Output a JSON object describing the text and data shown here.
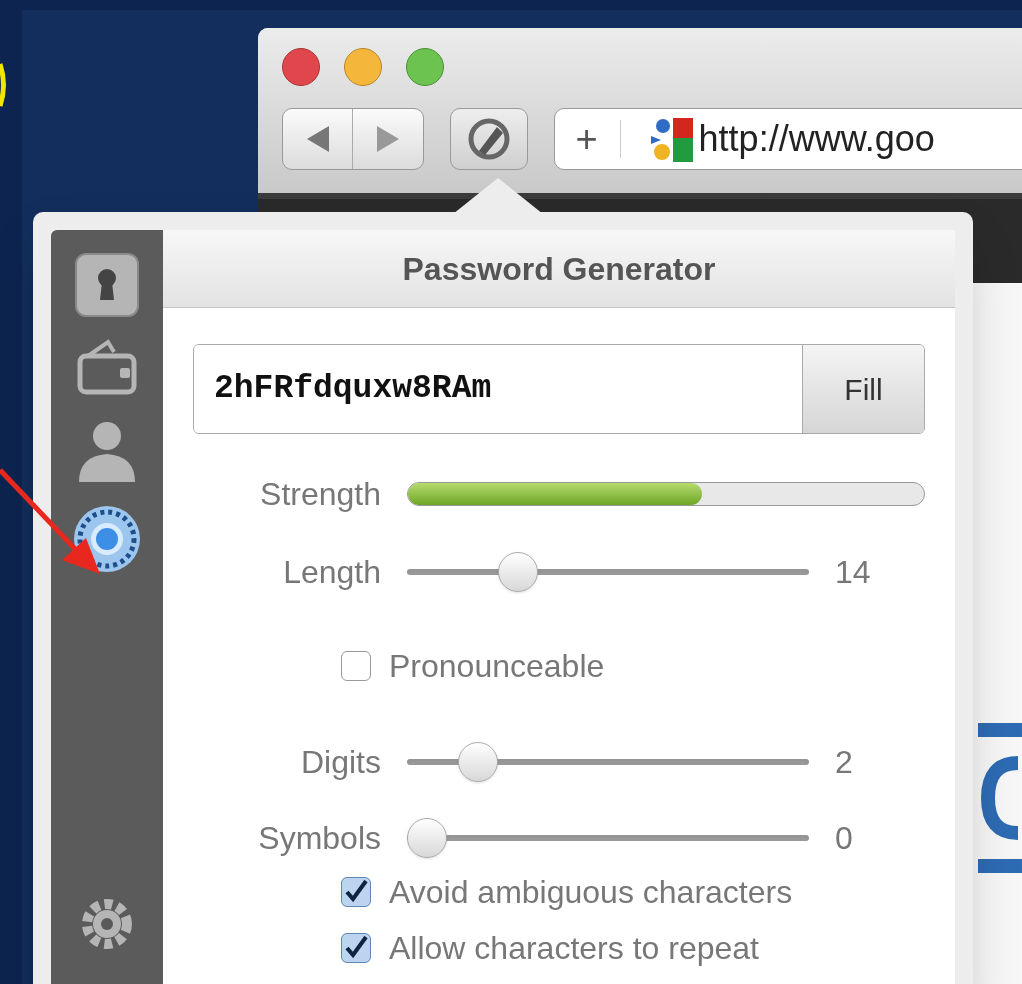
{
  "browser": {
    "new_tab_button": "+",
    "address_bar": {
      "url": "http://www.goo"
    }
  },
  "popup": {
    "title": "Password Generator",
    "sidebar": [
      {
        "kind": "vault",
        "selected": false
      },
      {
        "kind": "wallet",
        "selected": false
      },
      {
        "kind": "identity",
        "selected": false
      },
      {
        "kind": "generator",
        "selected": true
      },
      {
        "kind": "settings",
        "selected": false
      }
    ],
    "password": {
      "value": "2hFRfdquxw8RAm",
      "fill_button": "Fill"
    },
    "strength": {
      "label": "Strength",
      "level": 0.57
    },
    "length": {
      "label": "Length",
      "level": 0.25,
      "value": "14"
    },
    "pronounceable": {
      "label": "Pronounceable",
      "checked": false
    },
    "sliders": [
      {
        "label": "Digits",
        "level": 0.14,
        "value": "2"
      },
      {
        "label": "Symbols",
        "level": 0,
        "value": "0"
      }
    ],
    "options": [
      {
        "label": "Avoid ambiguous characters",
        "checked": true
      },
      {
        "label": "Allow characters to repeat",
        "checked": true
      }
    ]
  }
}
